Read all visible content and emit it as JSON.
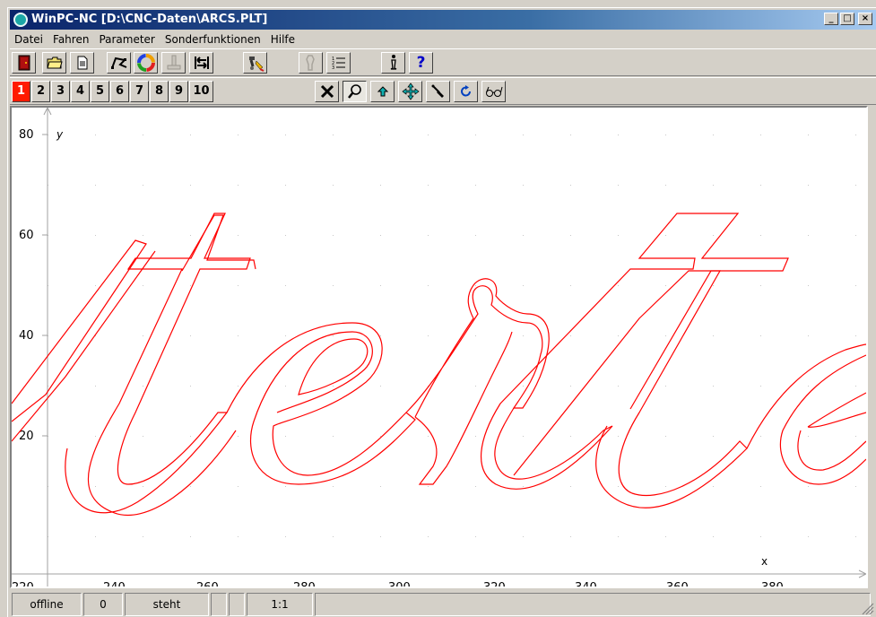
{
  "window": {
    "title": "WinPC-NC [D:\\CNC-Daten\\ARCS.PLT]",
    "minimize": "_",
    "maximize": "□",
    "close": "×"
  },
  "menu": [
    "Datei",
    "Fahren",
    "Parameter",
    "Sonderfunktionen",
    "Hilfe"
  ],
  "toolbar1": [
    {
      "name": "exit-button",
      "icon": "door-icon"
    },
    {
      "name": "open-file-button",
      "icon": "folder-icon"
    },
    {
      "name": "file-info-button",
      "icon": "document-icon"
    },
    {
      "name": "path-edit-button",
      "icon": "polyline-icon"
    },
    {
      "name": "color-assign-button",
      "icon": "color-wheel-icon"
    },
    {
      "name": "reference-run-button",
      "icon": "axis-tool-icon",
      "disabled": true
    },
    {
      "name": "move-origin-button",
      "icon": "home-arrow-icon"
    },
    {
      "name": "start-job-button",
      "icon": "machine-run-icon"
    },
    {
      "name": "tool-change-button",
      "icon": "tool-icon",
      "disabled": true
    },
    {
      "name": "job-list-button",
      "icon": "list-icon"
    },
    {
      "name": "info-button",
      "icon": "info-icon"
    },
    {
      "name": "help-button",
      "icon": "question-icon",
      "label": "?"
    }
  ],
  "layers": {
    "labels": [
      "1",
      "2",
      "3",
      "4",
      "5",
      "6",
      "7",
      "8",
      "9",
      "10"
    ],
    "active": "1"
  },
  "toolbar2": [
    {
      "name": "delete-view-button",
      "icon": "x-icon"
    },
    {
      "name": "zoom-button",
      "icon": "magnifier-icon",
      "pressed": true
    },
    {
      "name": "zoom-up-button",
      "icon": "arrow-up-icon"
    },
    {
      "name": "pan-button",
      "icon": "move-arrows-icon"
    },
    {
      "name": "select-tool-button",
      "icon": "pick-icon"
    },
    {
      "name": "refresh-button",
      "icon": "rotate-icon"
    },
    {
      "name": "preview-button",
      "icon": "glasses-icon"
    }
  ],
  "plot": {
    "axis_x_label": "x",
    "axis_y_label": "y",
    "y_ticks": [
      "80",
      "60",
      "40",
      "20"
    ],
    "x_ticks_partial": [
      "220",
      "240",
      "260",
      "280",
      "300",
      "320",
      "340",
      "360",
      "380"
    ],
    "line_color": "#ff0000",
    "grid_color": "#c8c8c8"
  },
  "status": {
    "connection": "offline",
    "counter": "0",
    "motion": "steht",
    "scale": "1:1"
  }
}
